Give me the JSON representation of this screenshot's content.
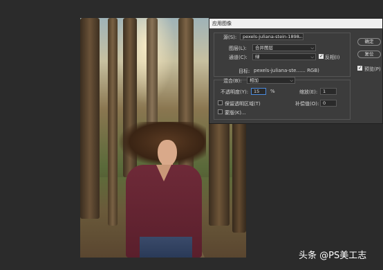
{
  "dialog": {
    "title": "应用图像",
    "source_label": "源(S):",
    "source_value": "pexels-juliana-stein-1898...",
    "layer_label": "图层(L):",
    "layer_value": "合并图层",
    "channel_label": "通道(C):",
    "channel_value": "绿",
    "invert_label": "反相(I)",
    "invert_checked": true,
    "target_label": "目标:",
    "target_value": "pexels-juliana-ste...... RGB)",
    "blending_label": "混合(B):",
    "blending_value": "相加",
    "opacity_label": "不透明度(Y):",
    "opacity_value": "15",
    "opacity_unit": "%",
    "scale_label": "缩放(E):",
    "scale_value": "1",
    "offset_label": "补偿值(O):",
    "offset_value": "0",
    "preserve_label": "保留透明区域(T)",
    "mask_label": "蒙版(K)...",
    "ok_label": "确定",
    "reset_label": "复位",
    "preview_label": "预览(P)",
    "preview_checked": true
  },
  "watermark": "头条 @PS美工志"
}
